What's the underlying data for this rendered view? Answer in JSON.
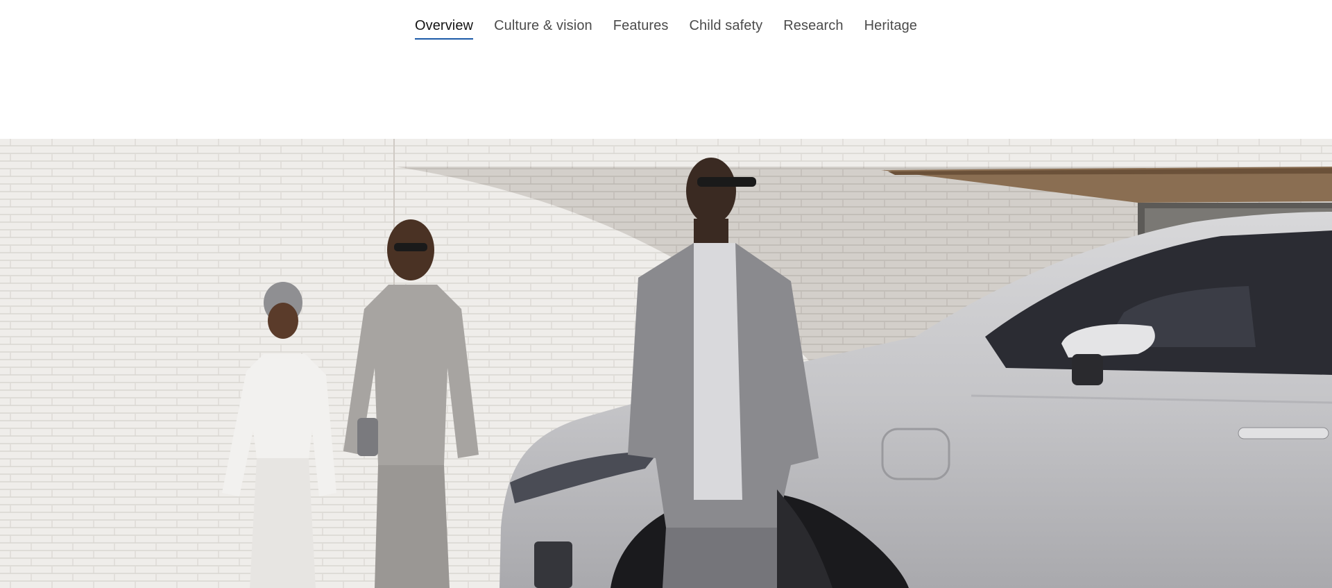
{
  "subnav": {
    "items": [
      {
        "label": "Overview",
        "active": true
      },
      {
        "label": "Culture & vision",
        "active": false
      },
      {
        "label": "Features",
        "active": false
      },
      {
        "label": "Child safety",
        "active": false
      },
      {
        "label": "Research",
        "active": false
      },
      {
        "label": "Heritage",
        "active": false
      }
    ]
  },
  "colors": {
    "active_underline": "#1c5aa8",
    "nav_text": "#4b4b4b",
    "nav_text_active": "#141414"
  }
}
